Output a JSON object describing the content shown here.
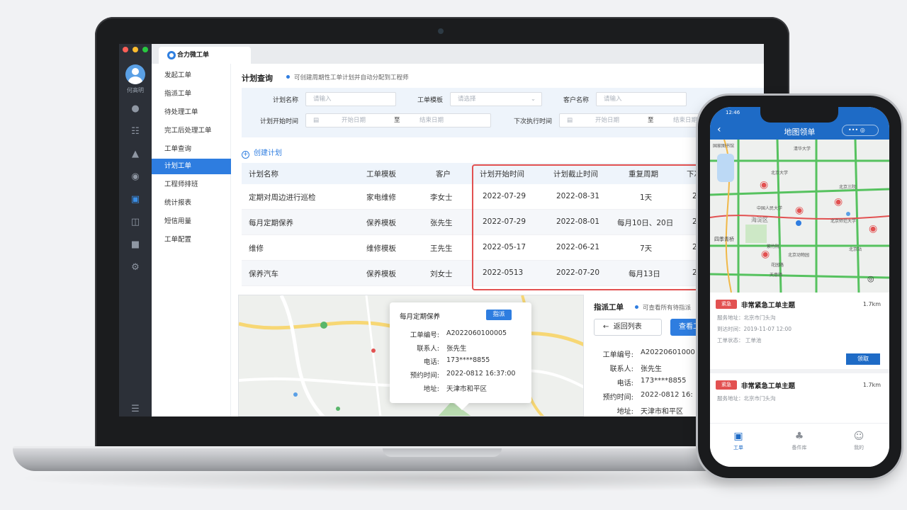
{
  "app": {
    "name": "合力微工单",
    "username": "何高明"
  },
  "menu": [
    "发起工单",
    "指派工单",
    "待处理工单",
    "完工后处理工单",
    "工单查询",
    "计划工单",
    "工程师排班",
    "统计报表",
    "短信用量",
    "工单配置"
  ],
  "menu_active_index": 5,
  "side_icons": [
    "chat-icon",
    "org-icon",
    "stamp-icon",
    "badge-icon",
    "image-icon",
    "database-icon",
    "building-icon",
    "gear-icon",
    "menu-icon"
  ],
  "page": {
    "title": "计划查询",
    "hint": "可创建周期性工单计划并自动分配到工程师",
    "create_label": "创建计划"
  },
  "filters": {
    "plan_name_label": "计划名称",
    "plan_name_placeholder": "请输入",
    "template_label": "工单模板",
    "template_placeholder": "请选择",
    "customer_label": "客户名称",
    "customer_placeholder": "请输入",
    "start_time_label": "计划开始时间",
    "start_from": "开始日期",
    "to": "至",
    "start_to": "结束日期",
    "next_exec_label": "下次执行时间",
    "next_from": "开始日期",
    "next_to": "结束日期"
  },
  "table": {
    "headers": [
      "计划名称",
      "工单模板",
      "客户",
      "计划开始时间",
      "计划截止时间",
      "重复周期",
      "下次"
    ],
    "rows": [
      [
        "定期对周边进行巡检",
        "家电维修",
        "李女士",
        "2022-07-29",
        "2022-08-31",
        "1天",
        "20"
      ],
      [
        "每月定期保养",
        "保养模板",
        "张先生",
        "2022-07-29",
        "2022-08-01",
        "每月10日、20日",
        "20"
      ],
      [
        "维修",
        "维修模板",
        "王先生",
        "2022-05-17",
        "2022-06-21",
        "7天",
        "20"
      ],
      [
        "保养汽车",
        "保养模板",
        "刘女士",
        "2022-0513",
        "2022-07-20",
        "每月13日",
        "20"
      ]
    ]
  },
  "popup": {
    "title": "每月定期保养",
    "button": "指派",
    "fields": [
      {
        "k": "工单编号:",
        "v": "A2022060100005"
      },
      {
        "k": "联系人:",
        "v": "张先生"
      },
      {
        "k": "电话:",
        "v": "173****8855"
      },
      {
        "k": "预约时间:",
        "v": "2022-0812 16:37:00"
      },
      {
        "k": "地址:",
        "v": "天津市和平区"
      }
    ]
  },
  "dispatch": {
    "title": "指派工单",
    "hint": "可查看所有待指派",
    "back_label": "返回列表",
    "view_label": "查看工",
    "fields": [
      {
        "k": "工单编号:",
        "v": "A20220601000"
      },
      {
        "k": "联系人:",
        "v": "张先生"
      },
      {
        "k": "电话:",
        "v": "173****8855"
      },
      {
        "k": "预约时间:",
        "v": "2022-0812 16:"
      },
      {
        "k": "地址:",
        "v": "天津市和平区"
      }
    ]
  },
  "phone": {
    "time": "12:46",
    "title": "地图领单",
    "capsule": "••• ◎",
    "map_labels": [
      "国家图书馆",
      "清华大学",
      "北京大学",
      "中国人民大学",
      "北京三院",
      "北京师范大学",
      "海淀区",
      "四季青桥",
      "紫竹院",
      "北京动物园",
      "北京站",
      "花园路",
      "天意镇"
    ],
    "cards": [
      {
        "tag": "紧急",
        "title": "非常紧急工单主题",
        "dist": "1.7km",
        "lines": [
          "服务地址：北京市门头沟",
          "到达时间：2019-11-07 12:00",
          "工单状态：  工单池"
        ],
        "button": "领取"
      },
      {
        "tag": "紧急",
        "title": "非常紧急工单主题",
        "dist": "1.7km",
        "lines": [
          "服务地址：北京市门头沟"
        ]
      }
    ],
    "nav": [
      "工单",
      "备件库",
      "我的"
    ]
  },
  "colors": {
    "accent": "#2e7de0",
    "danger": "#e25151",
    "sidebar": "#2c3038",
    "phone_header": "#1e6bc6"
  }
}
